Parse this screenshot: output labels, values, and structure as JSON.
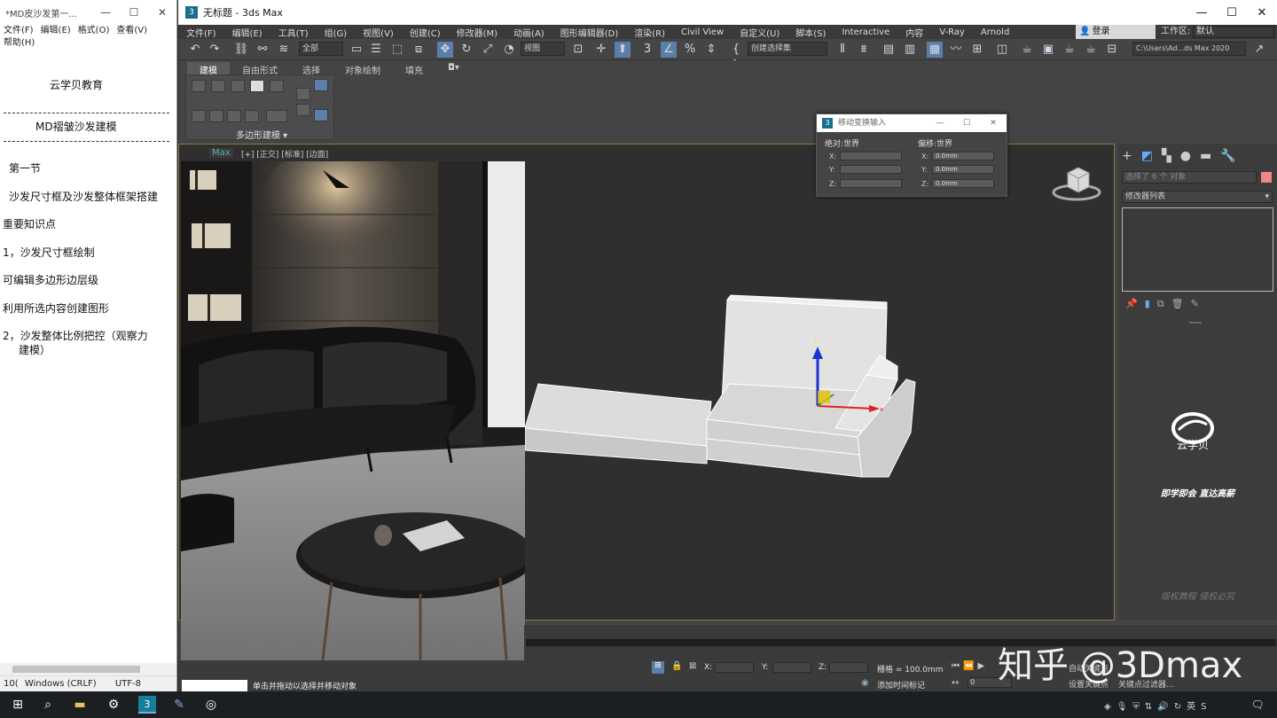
{
  "notepad": {
    "title": "*MD皮沙发第一...",
    "menu": [
      "文件(F)",
      "编辑(E)",
      "格式(O)",
      "查看(V)",
      "帮助(H)"
    ],
    "lines": {
      "org": "云学贝教育",
      "course": "MD褶皱沙发建模",
      "section": "第一节",
      "topic": "沙发尺寸框及沙发整体框架搭建",
      "keypoints": "重要知识点",
      "item1": "1，沙发尺寸框绘制",
      "item2": "可编辑多边形边层级",
      "item3": "利用所选内容创建图形",
      "item4a": "2，沙发整体比例把控（观察力",
      "item4b": "建模）"
    },
    "status": {
      "pos": "10(",
      "eol": "Windows (CRLF)",
      "enc": "UTF-8"
    }
  },
  "max": {
    "title": "无标题 - 3ds Max",
    "menu": [
      "文件(F)",
      "编辑(E)",
      "工具(T)",
      "组(G)",
      "视图(V)",
      "创建(C)",
      "修改器(M)",
      "动画(A)",
      "图形编辑器(D)",
      "渲染(R)",
      "Civil View",
      "自定义(U)",
      "脚本(S)",
      "Interactive",
      "内容",
      "V-Ray",
      "Arnold"
    ],
    "login": "登录",
    "workspace_label": "工作区:",
    "workspace_value": "默认",
    "toolbar": {
      "filter": "全部",
      "view": "视图",
      "selection_set": "创建选择集",
      "path": "C:\\Users\\Ad...ds Max 2020"
    },
    "ribbon_tabs": [
      "建模",
      "自由形式",
      "选择",
      "对象绘制",
      "填充"
    ],
    "ribbon_panel": "多边形建模",
    "viewport": {
      "tab": "Max",
      "label": "[+] [正交] [标准] [边面]"
    },
    "dialog": {
      "title": "移动变换输入",
      "abs_label": "绝对:世界",
      "offset_label": "偏移:世界",
      "x": "X:",
      "y": "Y:",
      "z": "Z:",
      "ox": "0.0mm",
      "oy": "0.0mm",
      "oz": "0.0mm"
    },
    "command_panel": {
      "selected": "选择了 6 个 对象",
      "modifier_list": "修改器列表",
      "logo_text": "云学贝",
      "slogan": "即学即会 直达高薪",
      "copyright": "版权教程 侵权必究"
    },
    "status": {
      "x": "X:",
      "y": "Y:",
      "z": "Z:",
      "grid": "栅格 = 100.0mm",
      "add_time_tag": "添加时间标记",
      "auto_key": "自动关键点",
      "set_key": "设置关键点",
      "key_filter": "关键点过滤器...",
      "frame": "0",
      "prompt": "单击并拖动以选择并移动对象"
    }
  },
  "watermark": "知乎 @3Dmax",
  "taskbar": {
    "ime": "英"
  }
}
